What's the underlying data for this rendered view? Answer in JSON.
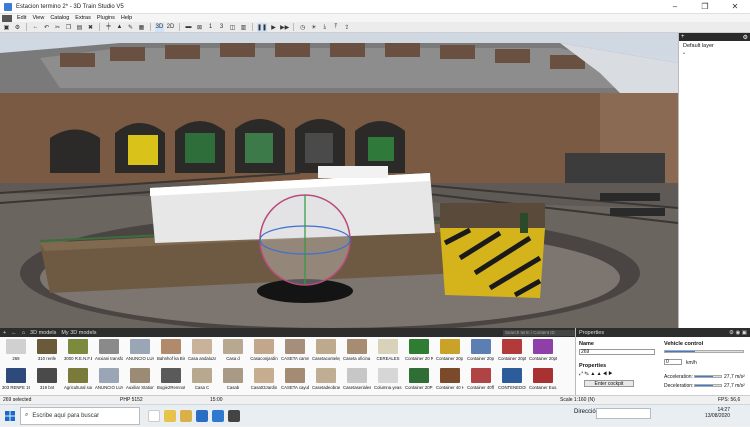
{
  "window": {
    "title": "Estacion termino 2* - 3D Train Studio V5",
    "controls": [
      "–",
      "❐",
      "✕"
    ]
  },
  "menu": [
    "Edit",
    "View",
    "Catalog",
    "Extras",
    "Plugins",
    "Help"
  ],
  "toolbar": {
    "items": [
      "3D",
      "2D",
      "1",
      "3"
    ]
  },
  "layers": {
    "title": "Default layer",
    "add": "+",
    "sub": "•"
  },
  "library": {
    "tabs": [
      "3D models",
      "My 3D models"
    ],
    "search_placeholder": "Search term / Content ID",
    "row1": [
      {
        "name": "269",
        "color": "#d0d0d0"
      },
      {
        "name": "310 renfe",
        "color": "#6b5a3a"
      },
      {
        "name": "3000 R.E.N.F.E...",
        "color": "#7b8a3d"
      },
      {
        "name": "Anxiani transfor...",
        "color": "#8a8a8a"
      },
      {
        "name": "ANUNCIO LUH ...",
        "color": "#9aa6b5"
      },
      {
        "name": "Bahnhof ka Binnie",
        "color": "#b08a6a"
      },
      {
        "name": "Casa andaluza 1",
        "color": "#c9b29a"
      },
      {
        "name": "Casa d",
        "color": "#b7a890"
      },
      {
        "name": "Casaconjardin",
        "color": "#c2a78c"
      },
      {
        "name": "CASETA camnio",
        "color": "#a68f7a"
      },
      {
        "name": "Casetacontelepos...",
        "color": "#bda98c"
      },
      {
        "name": "Caseta oficina m...",
        "color": "#a88c72"
      },
      {
        "name": "CEREALES",
        "color": "#d8d2b8"
      },
      {
        "name": "Container 20 Rente",
        "color": "#2e7d32"
      },
      {
        "name": "Container 20p C...",
        "color": "#c9a227"
      },
      {
        "name": "Container 20p 3...",
        "color": "#5b7fb3"
      },
      {
        "name": "Container 20pt",
        "color": "#b33a3a"
      },
      {
        "name": "Container 20pt 2",
        "color": "#8e3fa8"
      }
    ],
    "row2": [
      {
        "name": "303 RENFE 1953",
        "color": "#2d4a7a"
      },
      {
        "name": "319 bnt",
        "color": "#4a4a4a"
      },
      {
        "name": "Agricultural some...",
        "color": "#7a7a3a"
      },
      {
        "name": "ANUNCIO LUH ...",
        "color": "#9aa6b5"
      },
      {
        "name": "Auxiliar Station ...",
        "color": "#9b8a74"
      },
      {
        "name": "Bogie2Remnote",
        "color": "#5a5a5a"
      },
      {
        "name": "Casa C",
        "color": "#b8a890"
      },
      {
        "name": "Casab",
        "color": "#a89a84"
      },
      {
        "name": "Casa03Jardin",
        "color": "#c7ad8f"
      },
      {
        "name": "CASETA cayub...",
        "color": "#a48b74"
      },
      {
        "name": "Casetadeobras",
        "color": "#bfae93"
      },
      {
        "name": "Casetaseriales",
        "color": "#c7c7c7"
      },
      {
        "name": "Columna yeas bl...",
        "color": "#d6d6d6"
      },
      {
        "name": "Container 20P B...",
        "color": "#2f6e34"
      },
      {
        "name": "Container 40 Hl...",
        "color": "#7a4a2a"
      },
      {
        "name": "Container 40ff Vi...",
        "color": "#b04444"
      },
      {
        "name": "CONTENEDOR...",
        "color": "#2a5d9a"
      },
      {
        "name": "Container Eus...",
        "color": "#a83232"
      }
    ]
  },
  "properties": {
    "title": "Properties",
    "name_label": "Name",
    "name_value": "269",
    "vehicle_control": "Vehicle control",
    "speed_value": "0",
    "speed_unit": "km/h",
    "props_label": "Properties",
    "cockpit_button": "Enter cockpit",
    "acceleration_label": "Acceleration:",
    "acceleration_value": "27,7 m/s²",
    "deceleration_label": "Deceleration:",
    "deceleration_value": "27,7 m/s²"
  },
  "status": {
    "selected": "269 selected",
    "php": "PHP 5152",
    "time": "15:00",
    "scale": "Scale 1:160 (N)",
    "fps": "FPS: 56,6"
  },
  "taskbar": {
    "search": "Escribe aquí para buscar",
    "direccion": "Dirección",
    "clock_time": "14:27",
    "clock_date": "13/08/2020"
  }
}
